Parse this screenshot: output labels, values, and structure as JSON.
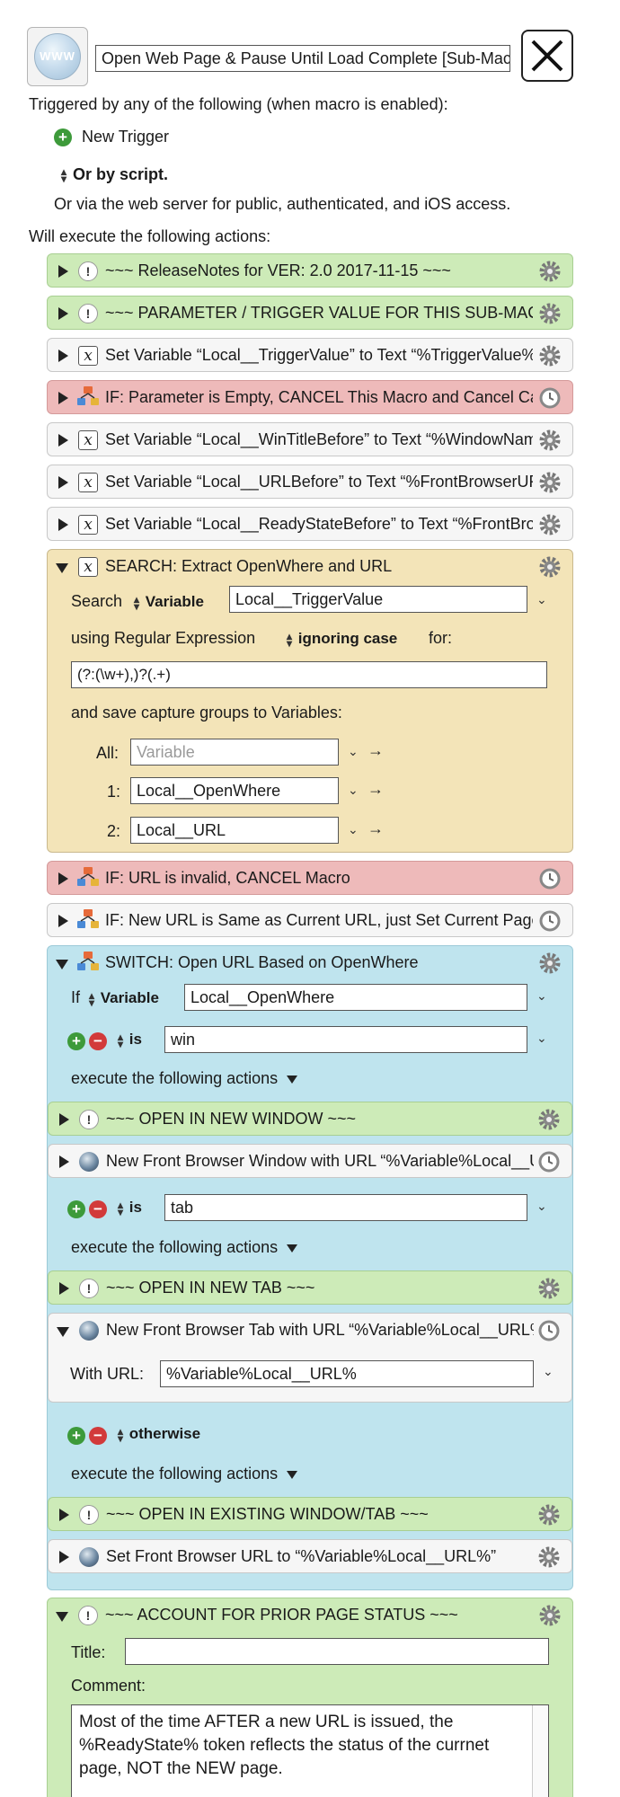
{
  "header": {
    "icon_text": "WWW",
    "macro_name": "Open Web Page & Pause Until Load Complete [Sub-Macro]"
  },
  "triggers": {
    "heading": "Triggered by any of the following (when macro is enabled):",
    "new_trigger": "New Trigger",
    "or_by_script": "Or by script.",
    "web_server": "Or via the web server for public, authenticated, and iOS access."
  },
  "actions_heading": "Will execute the following actions:",
  "rows": [
    {
      "label": "~~~ ReleaseNotes for  VER: 2.0    2017-11-15 ~~~"
    },
    {
      "label": "~~~ PARAMETER / TRIGGER VALUE FOR THIS SUB-MACRO ~~~"
    },
    {
      "label": "Set Variable “Local__TriggerValue” to Text “%TriggerValue%”"
    },
    {
      "label": "IF:  Parameter is Empty, CANCEL This Macro and Cancel Caller"
    },
    {
      "label": "Set Variable “Local__WinTitleBefore” to Text “%WindowName%”"
    },
    {
      "label": "Set Variable “Local__URLBefore” to Text “%FrontBrowserURL%”"
    },
    {
      "label": "Set Variable “Local__ReadyStateBefore” to Text “%FrontBrowserReadyState%”"
    }
  ],
  "search": {
    "title": "SEARCH: Extract OpenWhere and URL",
    "search_label": "Search",
    "source_type": "Variable",
    "source_value": "Local__TriggerValue",
    "using_label": "using Regular Expression",
    "case_option": "ignoring case",
    "for_label": "for:",
    "regex": "(?:(\\w+),)?(.+)",
    "save_label": "and save capture groups to Variables:",
    "groups": [
      {
        "label": "All:",
        "value": "",
        "placeholder": "Variable"
      },
      {
        "label": "1:",
        "value": "Local__OpenWhere",
        "placeholder": ""
      },
      {
        "label": "2:",
        "value": "Local__URL",
        "placeholder": ""
      }
    ]
  },
  "if_rows": [
    {
      "label": "IF:  URL is invalid, CANCEL Macro"
    },
    {
      "label": "IF:  New URL is Same as Current URL, just Set Current Page"
    }
  ],
  "switch": {
    "title": "SWITCH:  Open URL Based on OpenWhere",
    "if_label": "If",
    "source_type": "Variable",
    "source_value": "Local__OpenWhere",
    "is_label": "is",
    "case1_value": "win",
    "execute_label": "execute the following actions",
    "case1_rows": [
      {
        "label": "~~~ OPEN IN NEW WINDOW ~~~"
      },
      {
        "label": "New Front Browser Window with URL “%Variable%Local__URL%”"
      }
    ],
    "case2_value": "tab",
    "case2_rows": [
      {
        "label": "~~~ OPEN IN NEW TAB ~~~"
      }
    ],
    "new_tab": {
      "title": "New Front Browser Tab with URL “%Variable%Local__URL%”",
      "with_url_label": "With URL:",
      "url_value": "%Variable%Local__URL%"
    },
    "otherwise_label": "otherwise",
    "otherwise_rows": [
      {
        "label": "~~~ OPEN IN EXISTING WINDOW/TAB ~~~"
      },
      {
        "label": "Set Front Browser URL to “%Variable%Local__URL%”"
      }
    ]
  },
  "comment": {
    "title": "~~~ ACCOUNT FOR PRIOR PAGE STATUS ~~~",
    "title_label": "Title:",
    "title_value": "",
    "comment_label": "Comment:",
    "text": "Most of the time AFTER a new URL is issued, the %ReadyState% token reflects the status of the currnet page, NOT the NEW page."
  },
  "colors": {
    "green": "#cdebb8",
    "red": "#eebaba",
    "yellow": "#f3e4b8",
    "blue": "#bfe4ee",
    "white": "#f6f6f6"
  }
}
